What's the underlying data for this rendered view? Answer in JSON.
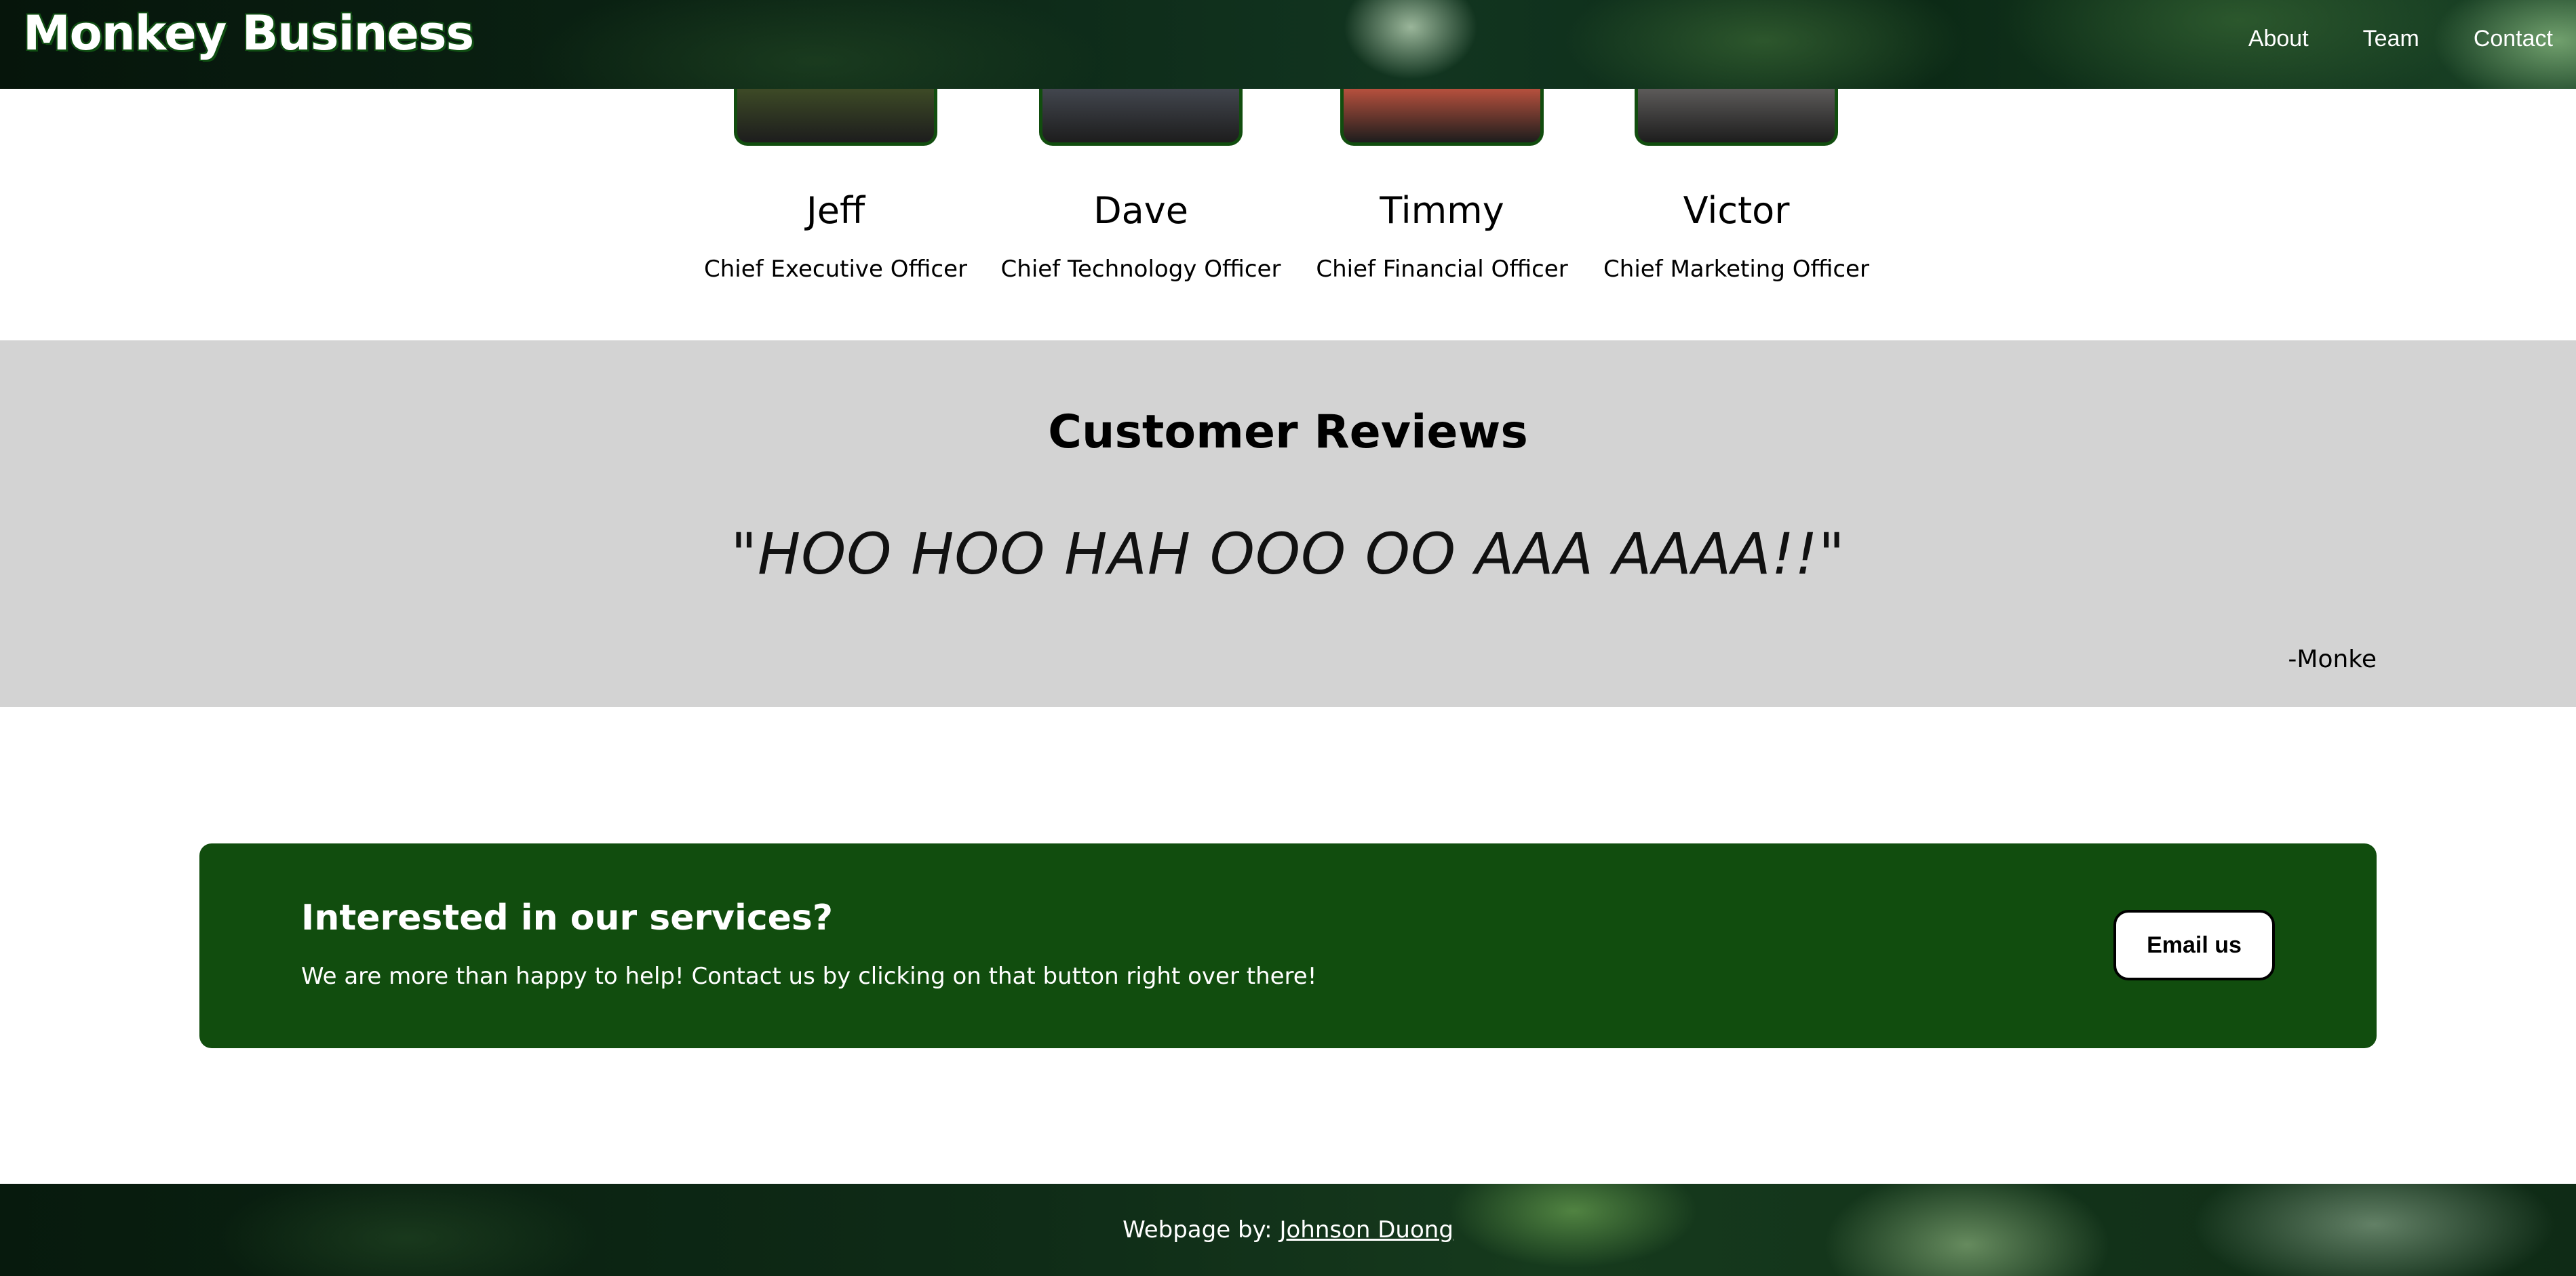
{
  "header": {
    "logo": "Monkey Business",
    "nav": [
      "About",
      "Team",
      "Contact"
    ]
  },
  "team": [
    {
      "name": "Jeff",
      "role": "Chief Executive Officer",
      "photo_color": "#3d4a26"
    },
    {
      "name": "Dave",
      "role": "Chief Technology Officer",
      "photo_color": "#42464e"
    },
    {
      "name": "Timmy",
      "role": "Chief Financial Officer",
      "photo_color": "#b6503d"
    },
    {
      "name": "Victor",
      "role": "Chief Marketing Officer",
      "photo_color": "#5c5a59"
    }
  ],
  "reviews": {
    "title": "Customer Reviews",
    "quote": "\"HOO HOO HAH OOO OO AAA AAAA!!\"",
    "author": "-Monke"
  },
  "cta": {
    "title": "Interested in our services?",
    "text": "We are more than happy to help! Contact us by clicking on that button right over there!",
    "button": "Email us"
  },
  "footer": {
    "prefix": "Webpage by: ",
    "author_link": "Johnson Duong"
  },
  "colors": {
    "brand_green": "#114d0e",
    "reviews_bg": "#d3d3d3"
  }
}
